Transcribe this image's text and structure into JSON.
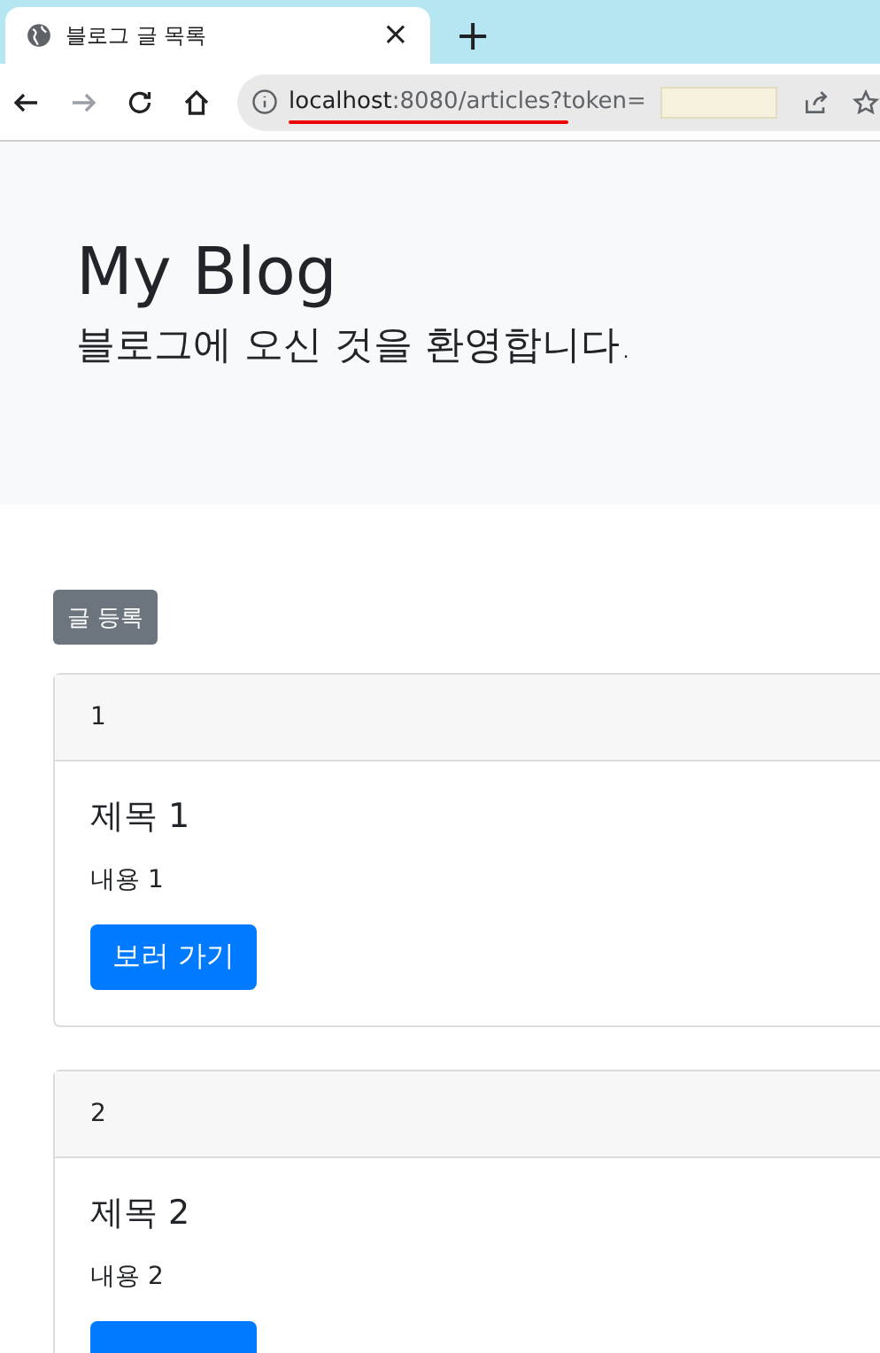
{
  "browser": {
    "tab_title": "블로그 글 목록",
    "close_symbol": "×",
    "new_tab_symbol": "+",
    "address_host": "localhost",
    "address_path": ":8080/articles?token="
  },
  "jumbotron": {
    "title": "My Blog",
    "subtitle": "블로그에 오신 것을 환영합니다."
  },
  "register_button": "글 등록",
  "articles": [
    {
      "id": "1",
      "title": "제목 1",
      "content": "내용 1",
      "button": "보러 가기"
    },
    {
      "id": "2",
      "title": "제목 2",
      "content": "내용 2"
    }
  ]
}
